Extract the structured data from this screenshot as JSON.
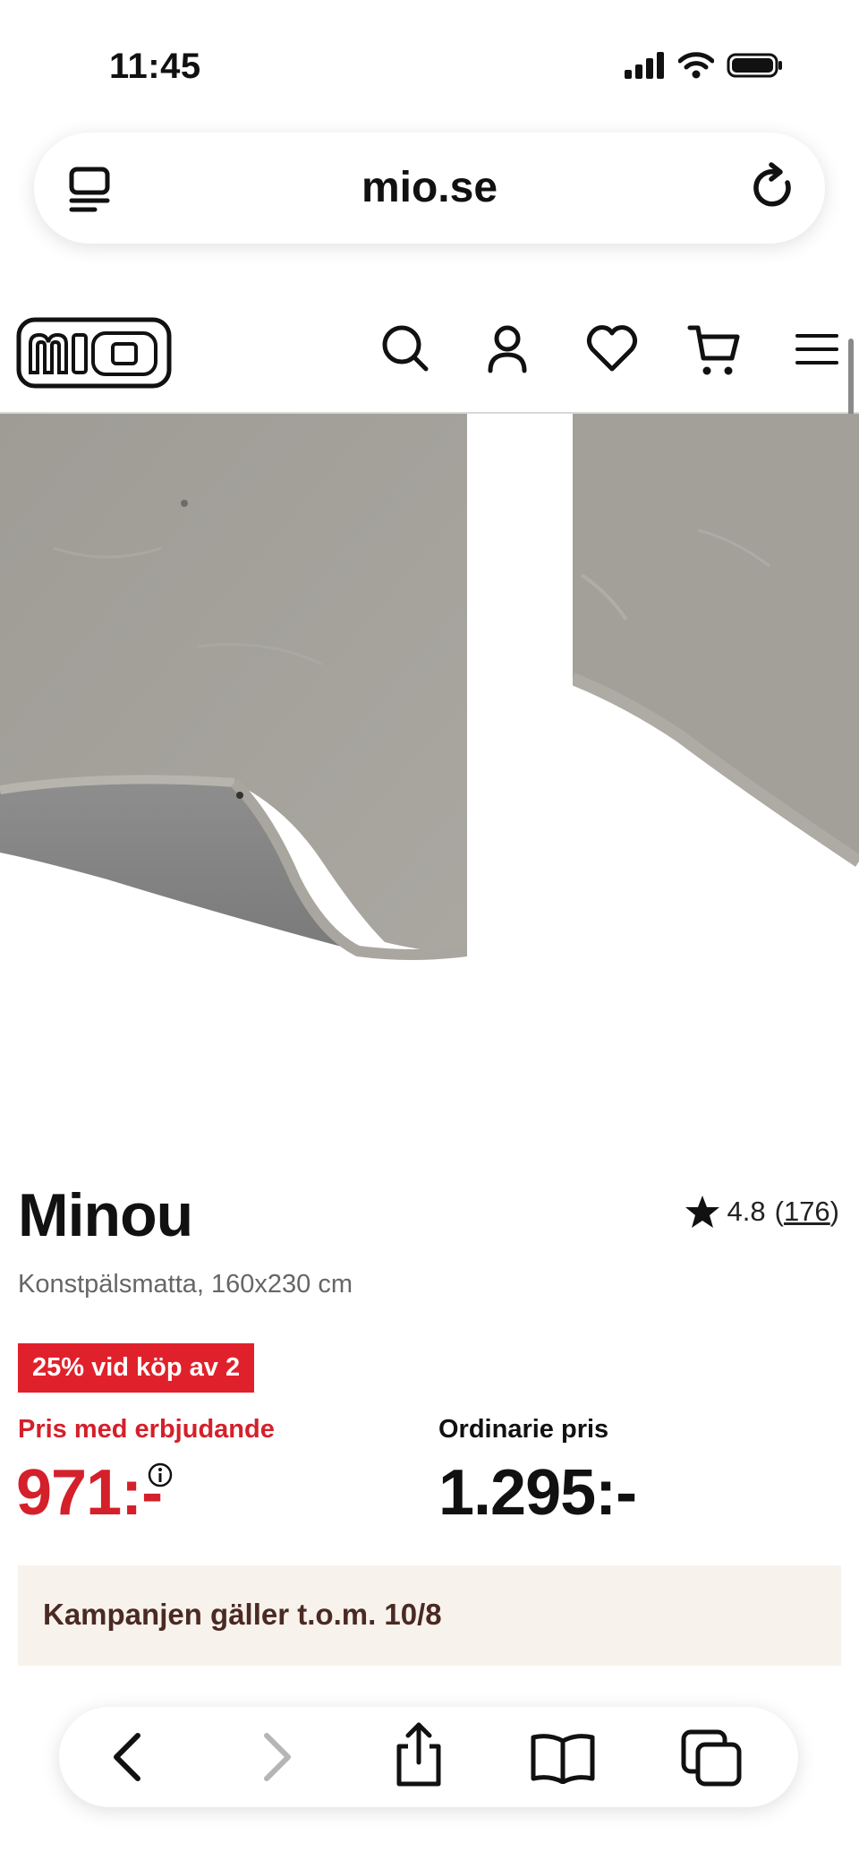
{
  "status_bar": {
    "time": "11:45",
    "icons": [
      "signal-icon",
      "wifi-icon",
      "battery-icon"
    ]
  },
  "browser": {
    "url": "mio.se",
    "icons": [
      "tabs-icon",
      "reload-icon"
    ]
  },
  "site_header": {
    "logo_text": "mio",
    "icons": [
      "search-icon",
      "account-icon",
      "heart-icon",
      "cart-icon",
      "menu-icon"
    ]
  },
  "product": {
    "title": "Minou",
    "subtitle": "Konstpälsmatta, 160x230 cm",
    "rating": {
      "value": "4.8",
      "open_paren": "(",
      "count": "176",
      "close_paren": ")"
    },
    "promo_badge": "25% vid köp av 2",
    "offer_label": "Pris med erbjudande",
    "offer_price": "971:-",
    "regular_label": "Ordinarie pris",
    "regular_price": "1.295:-",
    "campaign_text": "Kampanjen gäller t.o.m. 10/8"
  },
  "toolbar": {
    "icons": [
      "back-icon",
      "forward-icon",
      "share-icon",
      "bookmarks-icon",
      "tabs-overview-icon"
    ]
  },
  "colors": {
    "accent_red": "#e0212b",
    "campaign_bg": "#f8f2ec",
    "campaign_text": "#4a2a24",
    "rug_gray": "#a19e98"
  }
}
